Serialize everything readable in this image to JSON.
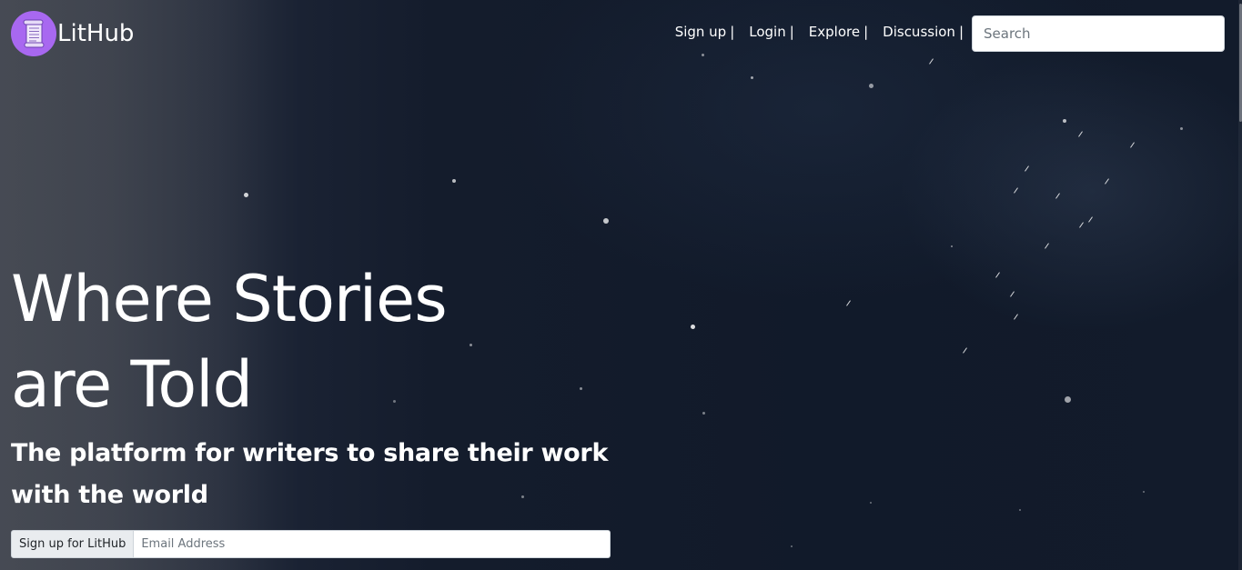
{
  "brand": {
    "name": "LitHub",
    "logo_icon": "scroll-icon",
    "logo_color": "#a868f0"
  },
  "nav": {
    "items": [
      {
        "label": "Sign up"
      },
      {
        "label": "Login"
      },
      {
        "label": "Explore"
      },
      {
        "label": "Discussion"
      }
    ],
    "separator": "|"
  },
  "search": {
    "placeholder": "Search",
    "value": ""
  },
  "hero": {
    "headline_line1": "Where Stories",
    "headline_line2": "are Told",
    "subheadline_line1": "The platform for writers to share their work",
    "subheadline_line2": "with the world",
    "background_icon": "starry-night-background"
  },
  "signup": {
    "button_label": "Sign up for LitHub",
    "email_placeholder": "Email Address",
    "email_value": ""
  }
}
